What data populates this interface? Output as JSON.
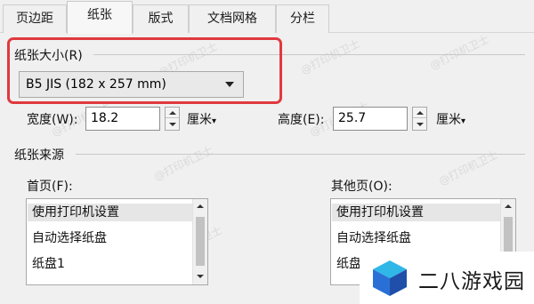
{
  "tabs": [
    {
      "label": "页边距",
      "active": false
    },
    {
      "label": "纸张",
      "active": true
    },
    {
      "label": "版式",
      "active": false
    },
    {
      "label": "文档网格",
      "active": false
    },
    {
      "label": "分栏",
      "active": false
    }
  ],
  "watermark_text": "@打印机卫士",
  "paper_size": {
    "group_label": "纸张大小(R)",
    "selected": "B5 JIS (182 x 257 mm)"
  },
  "width_field": {
    "label": "宽度(W):",
    "value": "18.2",
    "unit": "厘米"
  },
  "height_field": {
    "label": "高度(E):",
    "value": "25.7",
    "unit": "厘米"
  },
  "paper_source": {
    "group_label": "纸张来源",
    "first_page": {
      "label": "首页(F):",
      "items": [
        "使用打印机设置",
        "自动选择纸盘",
        "纸盘1"
      ],
      "selected_index": 0
    },
    "other_pages": {
      "label": "其他页(O):",
      "items": [
        "使用打印机设置",
        "自动选择纸盘",
        "纸盘1"
      ],
      "selected_index": 0
    }
  },
  "brand": {
    "name": "二八游戏园"
  },
  "colors": {
    "highlight": "#e0393e",
    "selection": "#e6e6e6",
    "logo_blue": "#2a6fd6",
    "logo_cyan": "#2fb7e8"
  }
}
